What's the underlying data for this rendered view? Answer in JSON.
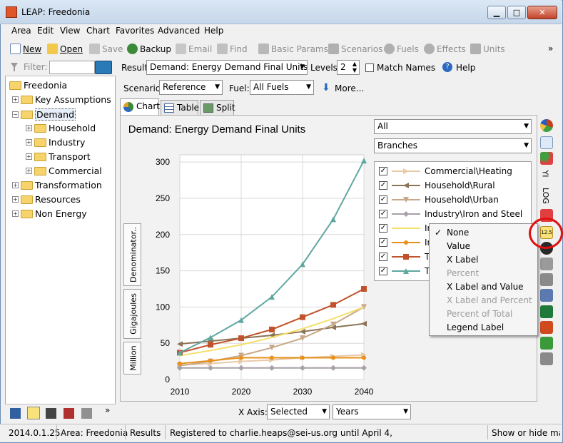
{
  "window": {
    "title": "LEAP: Freedonia",
    "min_label": "▁",
    "max_label": "□",
    "close_label": "✕"
  },
  "menu": [
    "Area",
    "Edit",
    "View",
    "Chart",
    "Favorites",
    "Advanced",
    "Help"
  ],
  "toolbar": {
    "new": "New",
    "open": "Open",
    "save": "Save",
    "backup": "Backup",
    "email": "Email",
    "find": "Find",
    "basic_params": "Basic Params",
    "scenarios": "Scenarios",
    "fuels": "Fuels",
    "effects": "Effects",
    "units": "Units",
    "overflow": "»"
  },
  "filter": {
    "label": "Filter:",
    "value": ""
  },
  "tree": [
    {
      "label": "Freedonia",
      "level": 0
    },
    {
      "label": "Key Assumptions",
      "level": 1
    },
    {
      "label": "Demand",
      "level": 1
    },
    {
      "label": "Household",
      "level": 2
    },
    {
      "label": "Industry",
      "level": 2
    },
    {
      "label": "Transport",
      "level": 2
    },
    {
      "label": "Commercial",
      "level": 2
    },
    {
      "label": "Transformation",
      "level": 1
    },
    {
      "label": "Resources",
      "level": 1
    },
    {
      "label": "Non Energy",
      "level": 1
    }
  ],
  "left_bottom_overflow": "»",
  "controls": {
    "result_label": "Result:",
    "result_value": "Demand: Energy Demand Final Units",
    "levels_label": "Levels:",
    "levels_value": "2",
    "match_names": "Match Names",
    "help": "Help",
    "scenario_label": "Scenario:",
    "scenario_value": "Reference",
    "fuel_label": "Fuel:",
    "fuel_value": "All Fuels",
    "more": "More..."
  },
  "tabs": [
    "Chart",
    "Table",
    "Split"
  ],
  "chart_filters": {
    "top": "All",
    "second": "Branches"
  },
  "unit_buttons": [
    "Denominator..",
    "Gigajoules",
    "Million"
  ],
  "right_toolbar": {
    "yi": "YI",
    "log": "LOG"
  },
  "xaxis_controls": {
    "label": "X Axis:",
    "selected": "Selected",
    "years": "Years"
  },
  "context_menu": [
    {
      "label": "None",
      "checked": true,
      "enabled": true
    },
    {
      "label": "Value",
      "checked": false,
      "enabled": true
    },
    {
      "label": "X Label",
      "checked": false,
      "enabled": true
    },
    {
      "label": "Percent",
      "checked": false,
      "enabled": false
    },
    {
      "label": "X Label and Value",
      "checked": false,
      "enabled": true
    },
    {
      "label": "X Label and Percent",
      "checked": false,
      "enabled": false
    },
    {
      "label": "Percent of Total",
      "checked": false,
      "enabled": false
    },
    {
      "label": "Legend Label",
      "checked": false,
      "enabled": true
    }
  ],
  "status": {
    "version": "2014.0.1.25",
    "area": "Area: Freedonia",
    "view": "Results",
    "registered": "Registered to charlie.heaps@sei-us.org until April 4,",
    "hint": "Show or hide ma"
  },
  "chart_data": {
    "type": "line",
    "title": "Demand: Energy Demand Final Units",
    "x": [
      2010,
      2015,
      2020,
      2025,
      2030,
      2035,
      2040
    ],
    "xticks": [
      2010,
      2020,
      2030,
      2040
    ],
    "yticks": [
      0,
      50,
      100,
      150,
      200,
      250,
      300
    ],
    "ylim": [
      0,
      310
    ],
    "grid": true,
    "series": [
      {
        "name": "Commercial\\Heating",
        "color": "#e8c9a8",
        "marker": "triangle-right",
        "values": [
          20,
          22,
          25,
          27,
          30,
          32,
          34
        ],
        "legend_visible": true
      },
      {
        "name": "Household\\Rural",
        "color": "#8b7355",
        "marker": "triangle-left",
        "values": [
          49,
          53,
          57,
          61,
          66,
          72,
          77
        ],
        "legend_visible": true
      },
      {
        "name": "Household\\Urban",
        "color": "#c8a888",
        "marker": "triangle-down",
        "values": [
          19,
          25,
          33,
          44,
          57,
          76,
          100
        ],
        "legend_visible": true
      },
      {
        "name": "Industry\\Iron and Steel",
        "color": "#a8a0a8",
        "marker": "diamond",
        "values": [
          16,
          16,
          16,
          16,
          16,
          16,
          16
        ],
        "legend_visible": true
      },
      {
        "name": "In",
        "color": "#f5e06a",
        "marker": "none",
        "values": [
          33,
          40,
          48,
          58,
          70,
          84,
          100
        ],
        "legend_visible": true
      },
      {
        "name": "In",
        "color": "#e8901a",
        "marker": "circle",
        "values": [
          22,
          26,
          30,
          30,
          30,
          30,
          30
        ],
        "legend_visible": true
      },
      {
        "name": "Tr",
        "color": "#c0532b",
        "marker": "square",
        "values": [
          37,
          48,
          57,
          69,
          86,
          103,
          125
        ],
        "legend_visible": true
      },
      {
        "name": "Tr",
        "color": "#5fa8a0",
        "marker": "triangle-up",
        "values": [
          37,
          58,
          82,
          114,
          159,
          221,
          302
        ],
        "legend_visible": true
      }
    ]
  }
}
